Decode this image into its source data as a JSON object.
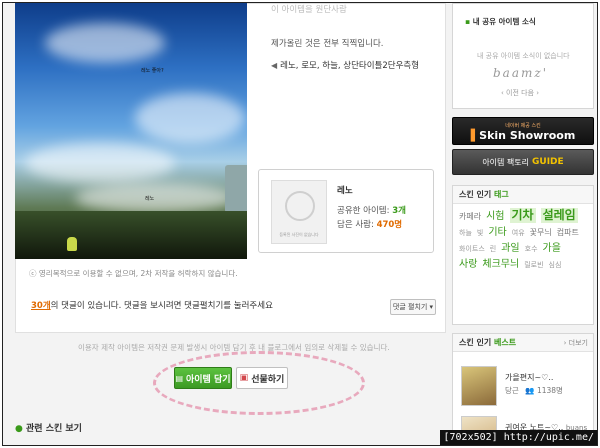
{
  "photo": {
    "caption": "레노 좋아?",
    "small_text_1": "레노",
    "small_text_2": "레노"
  },
  "item_desc": {
    "title_partial": "이 아이템을 원단사람",
    "line1": "제가올린 것은 전부 직찍입니다.",
    "tags_label": "레노, 로모, 하늘, 상단타이틀2단우측형"
  },
  "creator": {
    "name": "레노",
    "avatar_caption": "등록된 사진이 없습니다",
    "owned_label": "공유한 아이템:",
    "owned_count": "3개",
    "fans_label": "담은 사람:",
    "fans_count": "470명"
  },
  "notice": {
    "copyright": "영리목적으로 이용할 수 없으며, 2차 저작을 허락하지 않습니다."
  },
  "comments": {
    "count": "30개",
    "text": "의 댓글이 있습니다. 댓글을 보시려면 댓글펼치기를 눌러주세요",
    "expand_button": "댓글 펼치기 ▾"
  },
  "disclaimer": "이용자 제작 아이템은 저작권 문제 발생시 아이템 담기 후 내 블로그에서 임의로 삭제될 수 있습니다.",
  "actions": {
    "add_button": "아이템 담기",
    "gift_button": "선물하기"
  },
  "section": {
    "related_label": "관련 스킨 보기"
  },
  "sidebar": {
    "news_title": "내 공유 아이템 소식",
    "news_empty": "내 공유 아이템 소식이 없습니다",
    "handwriting": "baamz'",
    "nav": "‹ 이전  다음 ›",
    "skin_showroom_small": "네이버 제공 스킨",
    "skin_showroom": "Skin Showroom",
    "item_factory": "아이템 팩토리",
    "item_factory_guide": "GUIDE",
    "popular_tags_title": "스킨 인기",
    "popular_tags_hl": "태그",
    "tags": [
      {
        "t": "카페라",
        "s": "sz2"
      },
      {
        "t": "시험",
        "s": "sz3"
      },
      {
        "t": "기차",
        "s": "sz4"
      },
      {
        "t": "설레임",
        "s": "sz4"
      },
      {
        "t": "하늘",
        "s": "sz1"
      },
      {
        "t": "빛",
        "s": "sz1"
      },
      {
        "t": "기타",
        "s": "sz3"
      },
      {
        "t": "여유",
        "s": "sz1"
      },
      {
        "t": "꽃무늬",
        "s": "sz2"
      },
      {
        "t": "컴파트",
        "s": "sz2"
      },
      {
        "t": "화이트스",
        "s": "sz1"
      },
      {
        "t": "린",
        "s": "sz1"
      },
      {
        "t": "과일",
        "s": "sz3"
      },
      {
        "t": "호수",
        "s": "sz1"
      },
      {
        "t": "가을",
        "s": "sz3"
      },
      {
        "t": "사랑",
        "s": "sz3"
      },
      {
        "t": "체크무늬",
        "s": "sz3"
      },
      {
        "t": "릴로빈",
        "s": "sz1"
      },
      {
        "t": "심심",
        "s": "sz1"
      }
    ],
    "best_title": "스킨 인기",
    "best_hl": "베스트",
    "best_more": "› 더보기",
    "best_items": [
      {
        "title": "가을편지~♡..",
        "author": "당근",
        "count": "1138명"
      },
      {
        "title": "귀여운 노트~♡..",
        "author": "buans",
        "count": ""
      }
    ]
  },
  "watermark": "[702x502] http://upic.me/"
}
